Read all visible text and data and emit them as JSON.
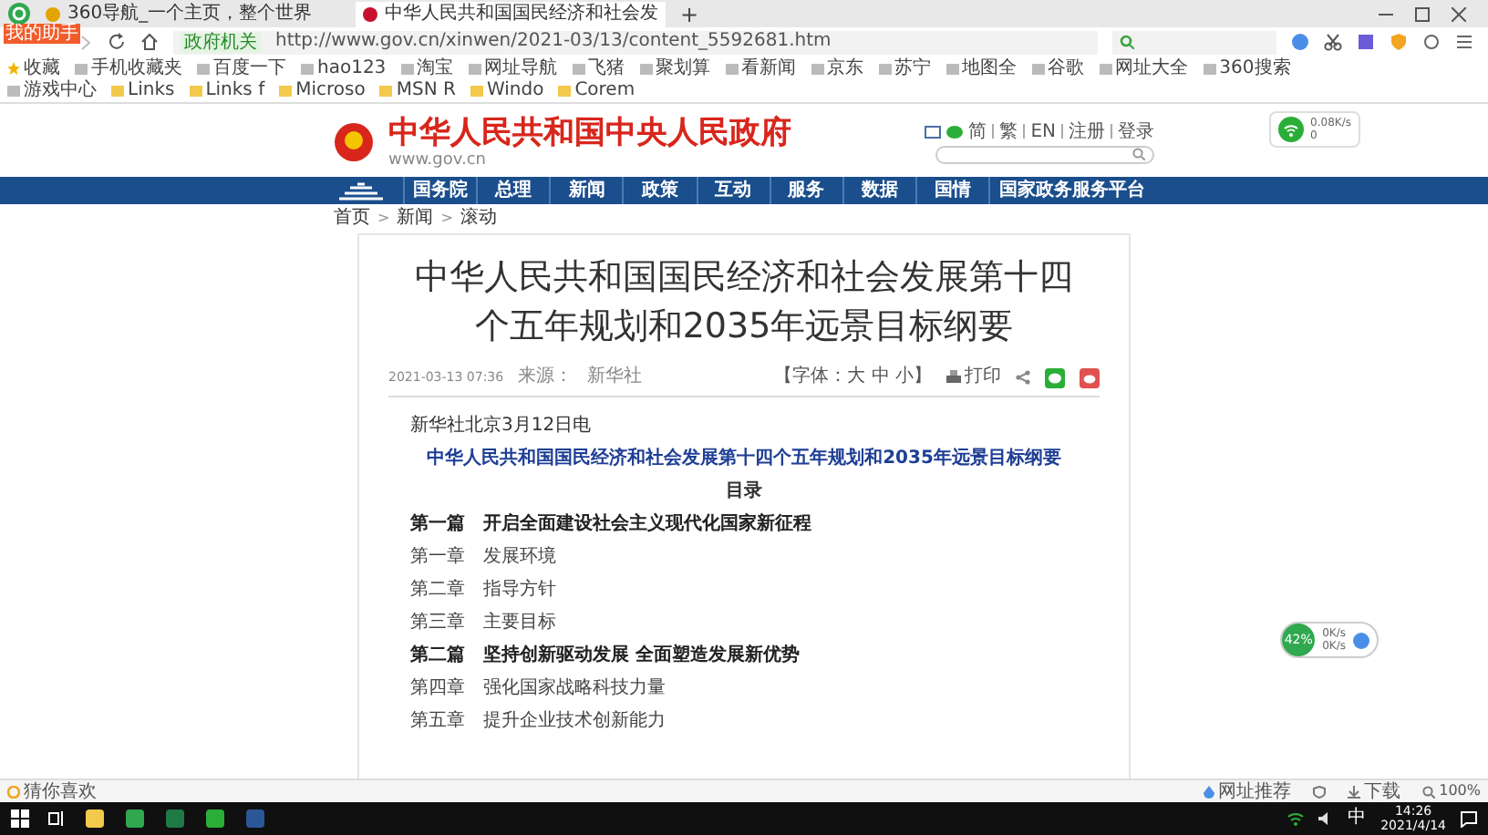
{
  "browser": {
    "badge": "我的助手",
    "tabs": [
      {
        "title": "360导航_一个主页，整个世界",
        "selected": false
      },
      {
        "title": "中华人民共和国国民经济和社会发",
        "selected": true
      }
    ],
    "new_tab": "+",
    "security_badge": "政府机关",
    "url": "http://www.gov.cn/xinwen/2021-03/13/content_5592681.htm",
    "bookmarks": [
      "收藏",
      "手机收藏夹",
      "百度一下",
      "hao123",
      "淘宝",
      "网址导航",
      "飞猪",
      "聚划算",
      "看新闻",
      "京东",
      "苏宁",
      "地图全",
      "谷歌",
      "网址大全",
      "360搜索",
      "游戏中心",
      "Links",
      "Links f",
      "Microso",
      "MSN R",
      "Windo",
      "Corem"
    ]
  },
  "site": {
    "title": "中华人民共和国中央人民政府",
    "domain": "www.gov.cn",
    "links": [
      "简",
      "繁",
      "EN",
      "注册",
      "登录"
    ],
    "nav": [
      "国务院",
      "总理",
      "新闻",
      "政策",
      "互动",
      "服务",
      "数据",
      "国情",
      "国家政务服务平台"
    ],
    "breadcrumb": [
      "首页",
      "新闻",
      "滚动"
    ],
    "breadcrumb_separator": ">"
  },
  "article": {
    "title": "中华人民共和国国民经济和社会发展第十四个五年规划和2035年远景目标纲要",
    "date": "2021-03-13 07:36",
    "source_label": "来源：",
    "source": "新华社",
    "font_size": "【字体：大 中 小】",
    "print": "打印",
    "dateline": "新华社北京3月12日电",
    "subtitle": "中华人民共和国国民经济和社会发展第十四个五年规划和2035年远景目标纲要",
    "toc": "目录",
    "items": [
      {
        "kind": "part",
        "num": "第一篇",
        "text": "开启全面建设社会主义现代化国家新征程"
      },
      {
        "kind": "chapter",
        "num": "第一章",
        "text": "发展环境"
      },
      {
        "kind": "chapter",
        "num": "第二章",
        "text": "指导方针"
      },
      {
        "kind": "chapter",
        "num": "第三章",
        "text": "主要目标"
      },
      {
        "kind": "part",
        "num": "第二篇",
        "text": "坚持创新驱动发展 全面塑造发展新优势"
      },
      {
        "kind": "chapter",
        "num": "第四章",
        "text": "强化国家战略科技力量"
      },
      {
        "kind": "chapter",
        "num": "第五章",
        "text": "提升企业技术创新能力"
      }
    ]
  },
  "widgets": {
    "net_speed": "0.08K/s",
    "net_count": "0",
    "cpu": "42%",
    "up": "0K/s",
    "down": "0K/s"
  },
  "status_bar": {
    "left": "猜你喜欢",
    "recommend": "网址推荐",
    "download": "下载",
    "zoom": "100%"
  },
  "taskbar": {
    "ime": "中",
    "time": "14:26",
    "date": "2021/4/14"
  }
}
